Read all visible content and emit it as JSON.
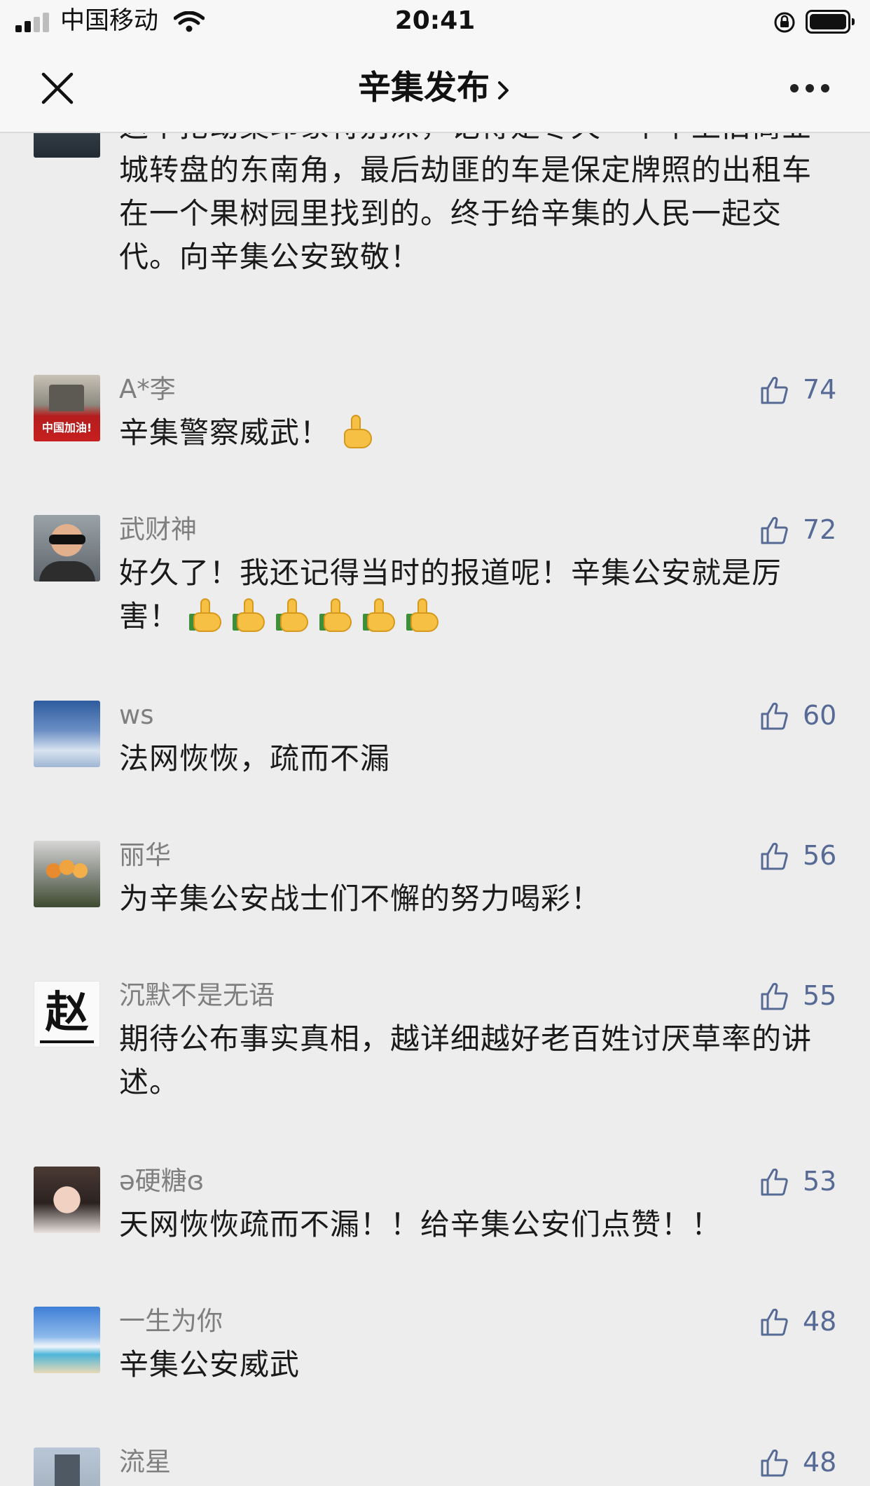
{
  "status_bar": {
    "carrier": "中国移动",
    "time": "20:41"
  },
  "nav": {
    "title": "辛集发布"
  },
  "colors": {
    "like_count": "#566a95",
    "username": "#7f7f7f",
    "background": "#ededed"
  },
  "comments": [
    {
      "username": "",
      "avatar": "dark-lake",
      "likes": "",
      "text": "这个抢劫案印象特别深，记得是冬天一个早上旧商业城转盘的东南角，最后劫匪的车是保定牌照的出租车在一个果树园里找到的。终于给辛集的人民一起交代。向辛集公安致敬！"
    },
    {
      "username": "A*李",
      "avatar": "flag",
      "avatar_text": "中国加油!",
      "likes": "74",
      "text": "辛集警察威武！",
      "emoji": "thumbs-up"
    },
    {
      "username": "武财神",
      "avatar": "person-sunglasses",
      "likes": "72",
      "text": "好久了！我还记得当时的报道呢！辛集公安就是厉害！",
      "emoji": "thumbs-up x6"
    },
    {
      "username": "ws",
      "avatar": "sky",
      "likes": "60",
      "text": "法网恢恢，疏而不漏"
    },
    {
      "username": "丽华",
      "avatar": "flower",
      "likes": "56",
      "text": "为辛集公安战士们不懈的努力喝彩！"
    },
    {
      "username": "沉默不是无语",
      "avatar": "zhao-character",
      "avatar_char": "赵",
      "likes": "55",
      "text": "期待公布事实真相，越详细越好老百姓讨厌草率的讲述。"
    },
    {
      "username": "ə硬糖ɞ",
      "avatar": "girl",
      "likes": "53",
      "text": "天网恢恢疏而不漏！！给辛集公安们点赞！！"
    },
    {
      "username": "一生为你",
      "avatar": "beach",
      "likes": "48",
      "text": "辛集公安威武"
    },
    {
      "username": "流星",
      "avatar": "building",
      "likes": "48",
      "text": ""
    }
  ]
}
